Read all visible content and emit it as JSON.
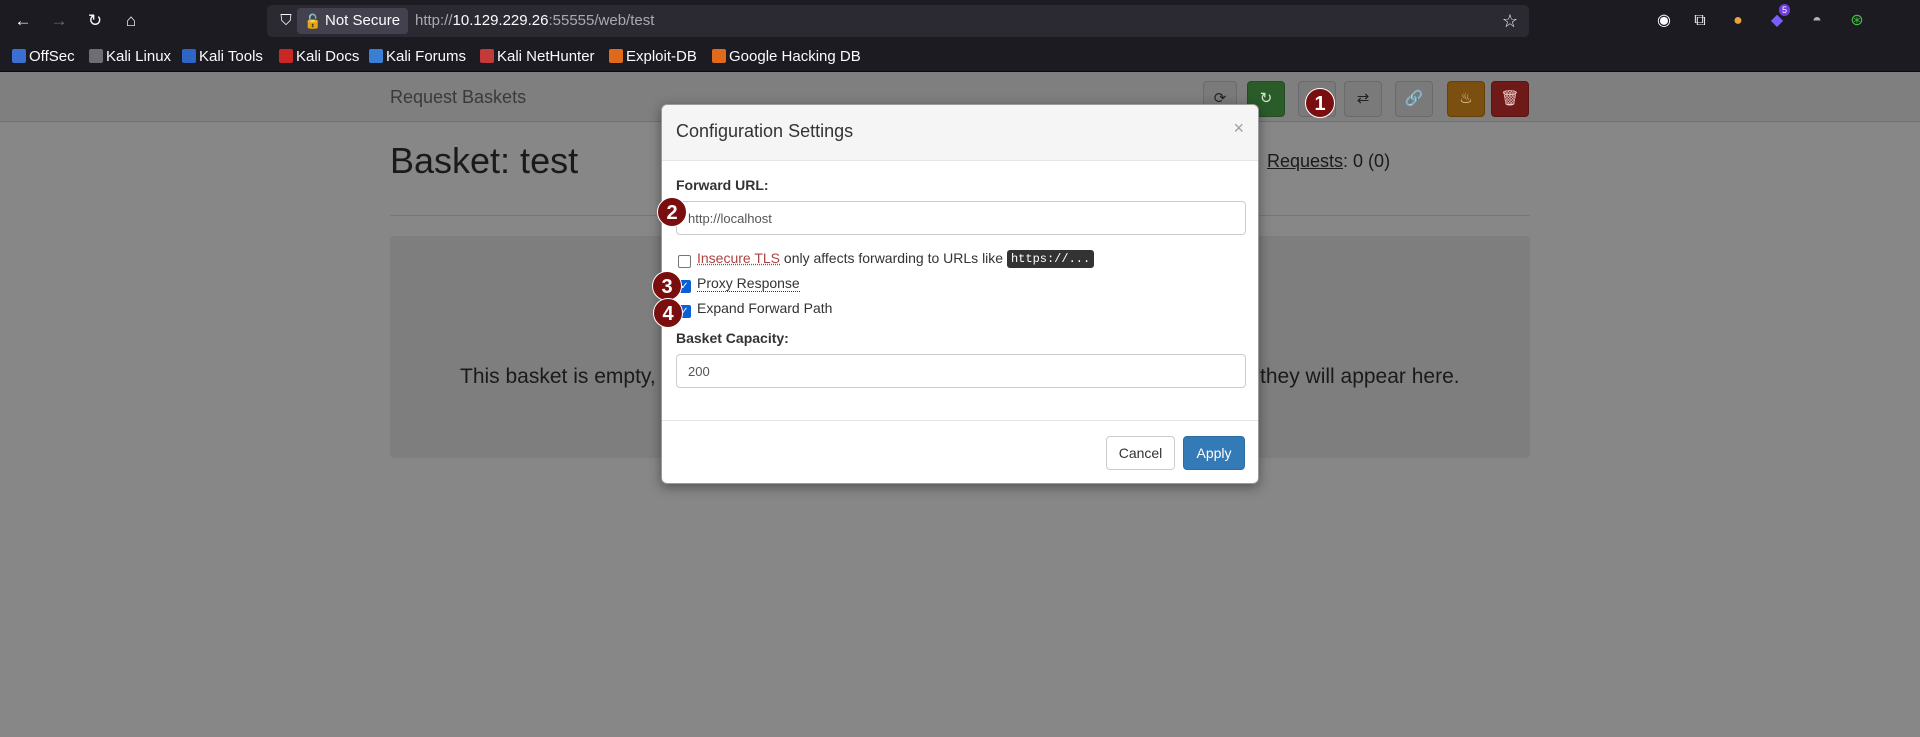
{
  "browser": {
    "security_label": "Not Secure",
    "url_prefix": "http://",
    "url_host": "10.129.229.26",
    "url_rest": ":55555/web/test",
    "extension_badge": "5",
    "bookmarks": [
      "OffSec",
      "Kali Linux",
      "Kali Tools",
      "Kali Docs",
      "Kali Forums",
      "Kali NetHunter",
      "Exploit-DB",
      "Google Hacking DB"
    ]
  },
  "app": {
    "brand": "Request Baskets",
    "basket_title": "Basket: test",
    "requests_label": "Requests",
    "requests_value": ": 0 (0)",
    "empty_left": "This basket is empty,",
    "empty_right": "they will appear here."
  },
  "modal": {
    "title": "Configuration Settings",
    "close": "×",
    "forward_url_label": "Forward URL:",
    "forward_url_value": "http://localhost",
    "insecure_tls": {
      "link": "Insecure TLS",
      "text": " only affects forwarding to URLs like ",
      "code": "https://...",
      "checked": false
    },
    "proxy_response": {
      "label": "Proxy Response",
      "checked": true
    },
    "expand_forward_path": {
      "label": "Expand Forward Path",
      "checked": true
    },
    "capacity_label": "Basket Capacity:",
    "capacity_value": "200",
    "cancel": "Cancel",
    "apply": "Apply"
  },
  "markers": [
    "1",
    "2",
    "3",
    "4"
  ],
  "colors": {
    "marker": "#7a0d0d",
    "apply": "#337ab7",
    "insecure": "#a94442"
  }
}
